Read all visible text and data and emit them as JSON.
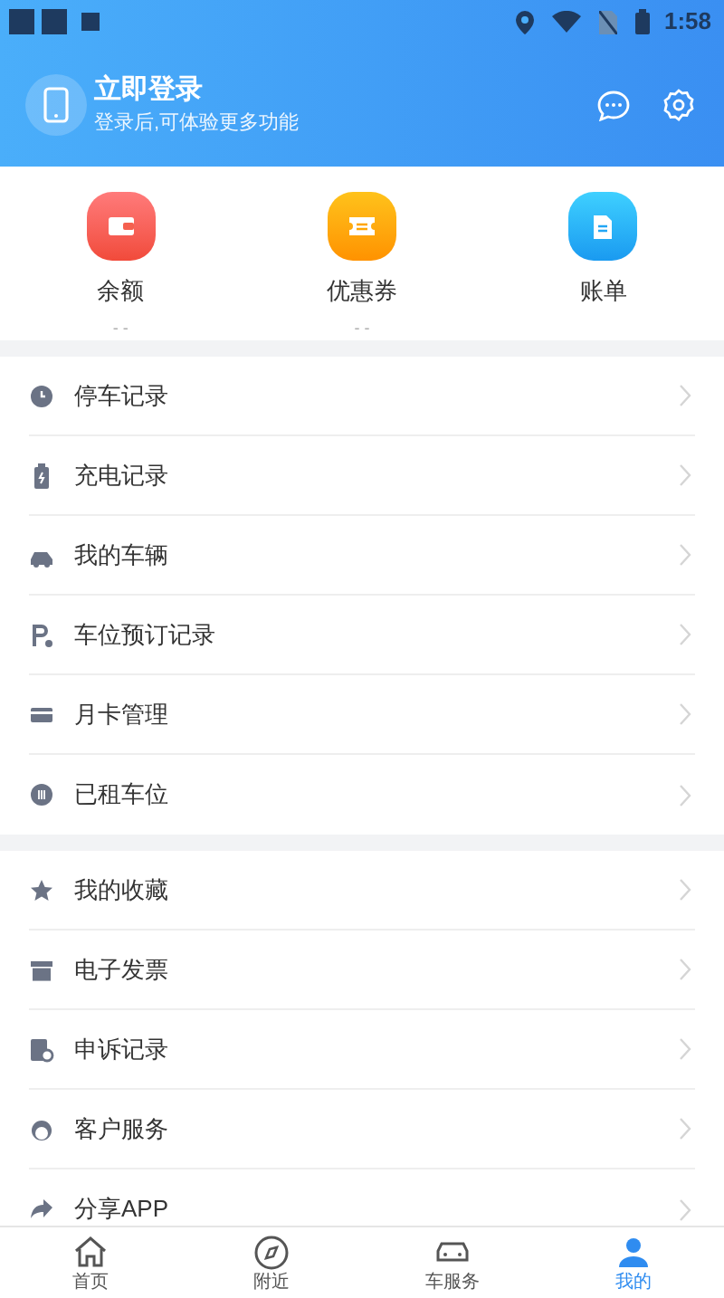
{
  "status_bar": {
    "time": "1:58"
  },
  "header": {
    "title": "立即登录",
    "subtitle": "登录后,可体验更多功能"
  },
  "quick_actions": [
    {
      "label": "余额",
      "value": "- -"
    },
    {
      "label": "优惠券",
      "value": "- -"
    },
    {
      "label": "账单"
    }
  ],
  "menu_groups": [
    [
      {
        "label": "停车记录"
      },
      {
        "label": "充电记录"
      },
      {
        "label": "我的车辆"
      },
      {
        "label": "车位预订记录"
      },
      {
        "label": "月卡管理"
      },
      {
        "label": "已租车位"
      }
    ],
    [
      {
        "label": "我的收藏"
      },
      {
        "label": "电子发票"
      },
      {
        "label": "申诉记录"
      },
      {
        "label": "客户服务"
      },
      {
        "label": "分享APP"
      }
    ]
  ],
  "tab_bar": [
    {
      "label": "首页",
      "selected": false
    },
    {
      "label": "附近",
      "selected": false
    },
    {
      "label": "车服务",
      "selected": false
    },
    {
      "label": "我的",
      "selected": true
    }
  ]
}
